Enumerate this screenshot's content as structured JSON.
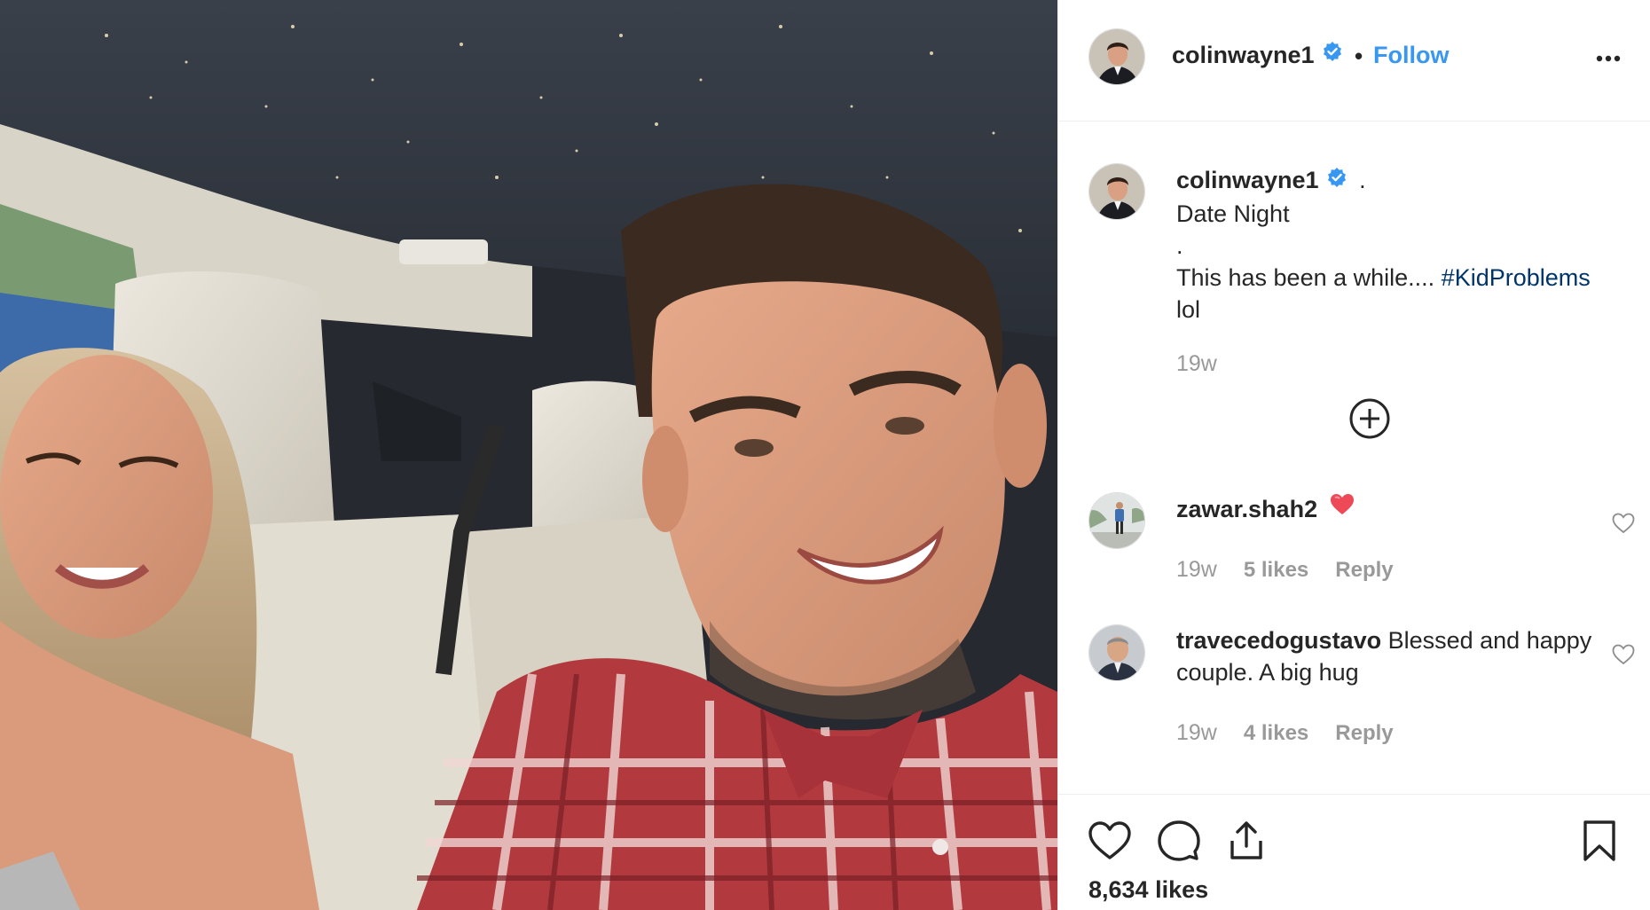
{
  "post": {
    "photo_icon": "post-photo",
    "author": {
      "username": "colinwayne1",
      "verified": true,
      "separator": "•",
      "follow_label": "Follow",
      "more_icon": "more-options-icon"
    },
    "caption": {
      "username": "colinwayne1",
      "after_name": ".",
      "lines": [
        "Date Night",
        ".",
        "This has been a while.... "
      ],
      "hashtag": "#KidProblems",
      "last_line": "lol",
      "time": "19w",
      "load_more_icon": "plus-circle-icon"
    },
    "comments": [
      {
        "username": "zawar.shah2",
        "text": "",
        "emoji": "❤️",
        "time": "19w",
        "likes": "5 likes",
        "reply_label": "Reply"
      },
      {
        "username": "travecedogustavo",
        "text": " Blessed and happy couple. A big hug",
        "time": "19w",
        "likes": "4 likes",
        "reply_label": "Reply"
      }
    ],
    "likes_count": "8,634 likes"
  },
  "colors": {
    "link_blue": "#3897f0",
    "hashtag": "#003569",
    "muted": "#999999",
    "text": "#262626",
    "heart_red": "#ed4956"
  }
}
